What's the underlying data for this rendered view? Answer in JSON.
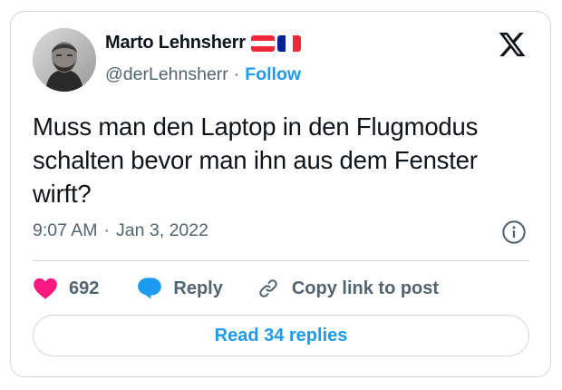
{
  "author": {
    "display_name": "Marto Lehnsherr",
    "handle": "@derLehnsherr",
    "separator": "·",
    "follow_label": "Follow",
    "flags": [
      "austria-flag",
      "france-flag"
    ]
  },
  "tweet": {
    "text": "Muss man den Laptop in den Flugmodus schalten bevor man ihn aus dem Fenster wirft?",
    "time": "9:07 AM",
    "separator": "·",
    "date": "Jan 3, 2022"
  },
  "actions": {
    "like_count": "692",
    "reply_label": "Reply",
    "copy_link_label": "Copy link to post"
  },
  "read_replies_label": "Read 34 replies",
  "colors": {
    "accent": "#1d9bf0",
    "like": "#f91880",
    "text": "#0f1419",
    "secondary": "#536471",
    "border": "#cfd9de"
  },
  "icons": [
    "x-logo-icon",
    "info-icon",
    "heart-icon",
    "reply-bubble-icon",
    "link-icon"
  ]
}
